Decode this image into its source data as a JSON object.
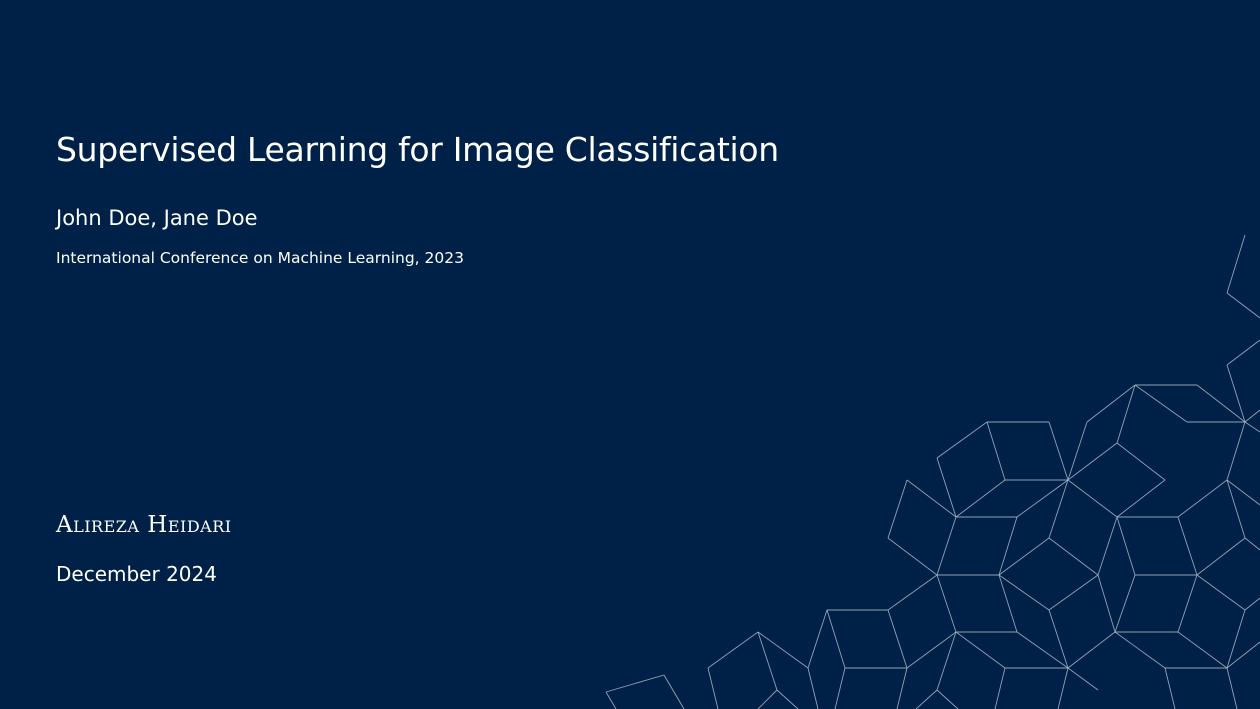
{
  "slide": {
    "title": "Supervised Learning for Image Classification",
    "authors": "John Doe, Jane Doe",
    "venue": "International Conference on Machine Learning, 2023",
    "presenter": "Alireza Heidari",
    "date": "December 2024"
  },
  "colors": {
    "background": "#002147",
    "text": "#ffffff",
    "pattern_lines": "#aab8c8"
  }
}
